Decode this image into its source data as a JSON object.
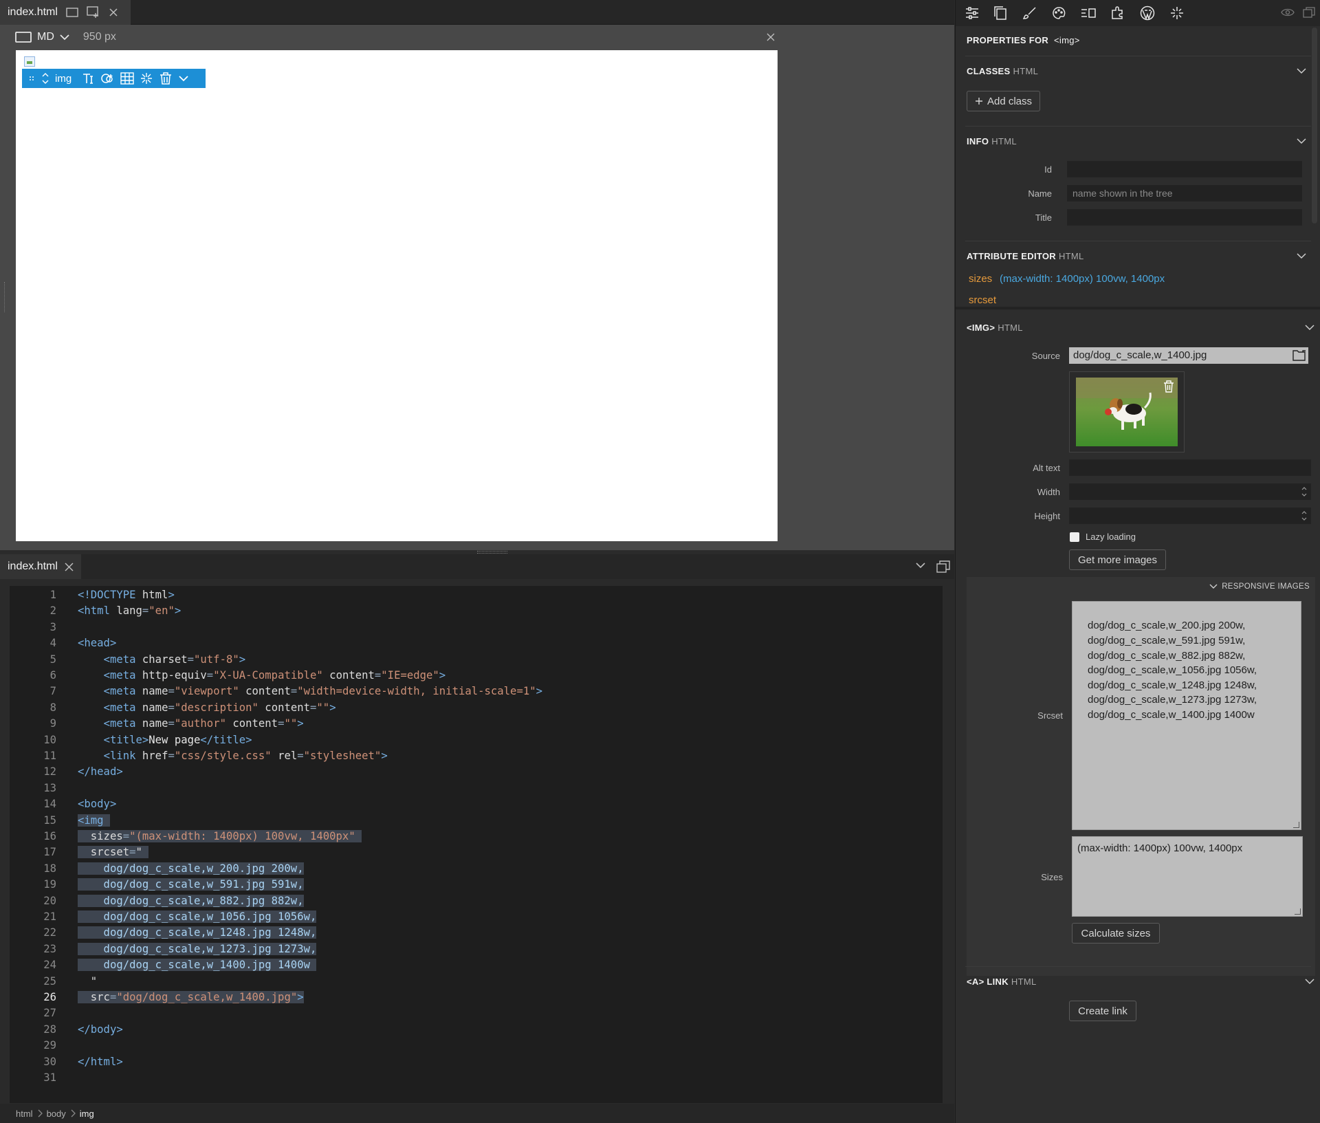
{
  "document_tab": {
    "title": "index.html"
  },
  "viewport": {
    "breakpoint": "MD",
    "width": "950 px"
  },
  "element_toolbar": {
    "tag": "img"
  },
  "code_tab": {
    "title": "index.html"
  },
  "code_lines": [
    {
      "n": "1",
      "tokens": [
        [
          "t-tag",
          "<!DOCTYPE "
        ],
        [
          "t-attr",
          "html"
        ],
        [
          "t-tag",
          ">"
        ]
      ]
    },
    {
      "n": "2",
      "tokens": [
        [
          "t-tag",
          "<html "
        ],
        [
          "t-attr",
          "lang"
        ],
        [
          "t-punc",
          "="
        ],
        [
          "t-val",
          "\"en\""
        ],
        [
          "t-tag",
          ">"
        ]
      ]
    },
    {
      "n": "3",
      "tokens": []
    },
    {
      "n": "4",
      "tokens": [
        [
          "t-tag",
          "<head>"
        ]
      ]
    },
    {
      "n": "5",
      "tokens": [
        [
          "t-plain",
          "    "
        ],
        [
          "t-tag",
          "<meta "
        ],
        [
          "t-attr",
          "charset"
        ],
        [
          "t-punc",
          "="
        ],
        [
          "t-val",
          "\"utf-8\""
        ],
        [
          "t-tag",
          ">"
        ]
      ]
    },
    {
      "n": "6",
      "tokens": [
        [
          "t-plain",
          "    "
        ],
        [
          "t-tag",
          "<meta "
        ],
        [
          "t-attr",
          "http-equiv"
        ],
        [
          "t-punc",
          "="
        ],
        [
          "t-val",
          "\"X-UA-Compatible\""
        ],
        [
          "t-attr",
          " content"
        ],
        [
          "t-punc",
          "="
        ],
        [
          "t-val",
          "\"IE=edge\""
        ],
        [
          "t-tag",
          ">"
        ]
      ]
    },
    {
      "n": "7",
      "tokens": [
        [
          "t-plain",
          "    "
        ],
        [
          "t-tag",
          "<meta "
        ],
        [
          "t-attr",
          "name"
        ],
        [
          "t-punc",
          "="
        ],
        [
          "t-val",
          "\"viewport\""
        ],
        [
          "t-attr",
          " content"
        ],
        [
          "t-punc",
          "="
        ],
        [
          "t-val",
          "\"width=device-width, initial-scale=1\""
        ],
        [
          "t-tag",
          ">"
        ]
      ]
    },
    {
      "n": "8",
      "tokens": [
        [
          "t-plain",
          "    "
        ],
        [
          "t-tag",
          "<meta "
        ],
        [
          "t-attr",
          "name"
        ],
        [
          "t-punc",
          "="
        ],
        [
          "t-val",
          "\"description\""
        ],
        [
          "t-attr",
          " content"
        ],
        [
          "t-punc",
          "="
        ],
        [
          "t-val",
          "\"\""
        ],
        [
          "t-tag",
          ">"
        ]
      ]
    },
    {
      "n": "9",
      "tokens": [
        [
          "t-plain",
          "    "
        ],
        [
          "t-tag",
          "<meta "
        ],
        [
          "t-attr",
          "name"
        ],
        [
          "t-punc",
          "="
        ],
        [
          "t-val",
          "\"author\""
        ],
        [
          "t-attr",
          " content"
        ],
        [
          "t-punc",
          "="
        ],
        [
          "t-val",
          "\"\""
        ],
        [
          "t-tag",
          ">"
        ]
      ]
    },
    {
      "n": "10",
      "tokens": [
        [
          "t-plain",
          "    "
        ],
        [
          "t-tag",
          "<title>"
        ],
        [
          "t-text",
          "New page"
        ],
        [
          "t-tag",
          "</title>"
        ]
      ]
    },
    {
      "n": "11",
      "tokens": [
        [
          "t-plain",
          "    "
        ],
        [
          "t-tag",
          "<link "
        ],
        [
          "t-attr",
          "href"
        ],
        [
          "t-punc",
          "="
        ],
        [
          "t-val",
          "\"css/style.css\""
        ],
        [
          "t-attr",
          " rel"
        ],
        [
          "t-punc",
          "="
        ],
        [
          "t-val",
          "\"stylesheet\""
        ],
        [
          "t-tag",
          ">"
        ]
      ]
    },
    {
      "n": "12",
      "tokens": [
        [
          "t-tag",
          "</head>"
        ]
      ]
    },
    {
      "n": "13",
      "tokens": []
    },
    {
      "n": "14",
      "tokens": [
        [
          "t-tag",
          "<body>"
        ]
      ]
    },
    {
      "n": "15",
      "hl": true,
      "tokens": [
        [
          "t-tag",
          "<img "
        ]
      ]
    },
    {
      "n": "16",
      "hl": true,
      "tokens": [
        [
          "t-plain",
          "  "
        ],
        [
          "t-attr",
          "sizes"
        ],
        [
          "t-punc",
          "="
        ],
        [
          "t-val",
          "\"(max-width: 1400px) 100vw, 1400px\" "
        ]
      ]
    },
    {
      "n": "17",
      "hl": true,
      "tokens": [
        [
          "t-plain",
          "  "
        ],
        [
          "t-attr",
          "srcset"
        ],
        [
          "t-punc",
          "="
        ],
        [
          "t-attr",
          "\" "
        ]
      ]
    },
    {
      "n": "18",
      "hl": true,
      "tokens": [
        [
          "t-plain",
          "    dog/dog_c_scale,w_200.jpg 200w,"
        ]
      ]
    },
    {
      "n": "19",
      "hl": true,
      "tokens": [
        [
          "t-plain",
          "    dog/dog_c_scale,w_591.jpg 591w,"
        ]
      ]
    },
    {
      "n": "20",
      "hl": true,
      "tokens": [
        [
          "t-plain",
          "    dog/dog_c_scale,w_882.jpg 882w,"
        ]
      ]
    },
    {
      "n": "21",
      "hl": true,
      "tokens": [
        [
          "t-plain",
          "    dog/dog_c_scale,w_1056.jpg 1056w,"
        ]
      ]
    },
    {
      "n": "22",
      "hl": true,
      "tokens": [
        [
          "t-plain",
          "    dog/dog_c_scale,w_1248.jpg 1248w,"
        ]
      ]
    },
    {
      "n": "23",
      "hl": true,
      "tokens": [
        [
          "t-plain",
          "    dog/dog_c_scale,w_1273.jpg 1273w,"
        ]
      ]
    },
    {
      "n": "24",
      "hl": true,
      "tokens": [
        [
          "t-plain",
          "    dog/dog_c_scale,w_1400.jpg 1400w "
        ]
      ]
    },
    {
      "n": "25",
      "tokens": [
        [
          "t-plain",
          "  "
        ],
        [
          "t-attr",
          "\""
        ]
      ]
    },
    {
      "n": "26",
      "hl": true,
      "active": true,
      "tokens": [
        [
          "t-plain",
          "  "
        ],
        [
          "t-attr",
          "src"
        ],
        [
          "t-punc",
          "="
        ],
        [
          "t-val",
          "\"dog/dog_c_scale,w_1400.jpg\""
        ],
        [
          "t-tag",
          ">"
        ]
      ]
    },
    {
      "n": "27",
      "tokens": []
    },
    {
      "n": "28",
      "tokens": [
        [
          "t-tag",
          "</body>"
        ]
      ]
    },
    {
      "n": "29",
      "tokens": []
    },
    {
      "n": "30",
      "tokens": [
        [
          "t-tag",
          "</html>"
        ]
      ]
    },
    {
      "n": "31",
      "tokens": []
    }
  ],
  "breadcrumb": [
    "html",
    "body",
    "img"
  ],
  "props": {
    "header": "PROPERTIES FOR",
    "header_tag": "<img>",
    "classes": {
      "title": "CLASSES",
      "kind": "HTML",
      "add_label": "Add class"
    },
    "info": {
      "title": "INFO",
      "kind": "HTML",
      "id_label": "Id",
      "id_value": "",
      "name_label": "Name",
      "name_placeholder": "name shown in the tree",
      "title_label": "Title",
      "title_value": ""
    },
    "attr_editor": {
      "title": "ATTRIBUTE EDITOR",
      "kind": "HTML",
      "attrs": [
        {
          "name": "sizes",
          "value": "(max-width: 1400px) 100vw, 1400px"
        },
        {
          "name": "srcset",
          "value": ""
        }
      ]
    },
    "img_section": {
      "title": "<IMG>",
      "kind": "HTML",
      "source_label": "Source",
      "source_value": "dog/dog_c_scale,w_1400.jpg",
      "alt_label": "Alt text",
      "alt_value": "",
      "width_label": "Width",
      "width_value": "",
      "height_label": "Height",
      "height_value": "",
      "lazy_label": "Lazy loading",
      "lazy_checked": false,
      "more_images_label": "Get more images"
    },
    "responsive": {
      "title": "RESPONSIVE IMAGES",
      "srcset_label": "Srcset",
      "srcset_lines": [
        "dog/dog_c_scale,w_200.jpg 200w,",
        "dog/dog_c_scale,w_591.jpg 591w,",
        "dog/dog_c_scale,w_882.jpg 882w,",
        "dog/dog_c_scale,w_1056.jpg 1056w,",
        "dog/dog_c_scale,w_1248.jpg 1248w,",
        "dog/dog_c_scale,w_1273.jpg 1273w,",
        "dog/dog_c_scale,w_1400.jpg 1400w"
      ],
      "sizes_label": "Sizes",
      "sizes_value": "(max-width: 1400px) 100vw, 1400px",
      "calc_label": "Calculate sizes"
    },
    "link": {
      "title": "<A> LINK",
      "kind": "HTML",
      "create_label": "Create link"
    }
  },
  "colors": {
    "accent": "#1d8fd6",
    "attr_name": "#e69a3c",
    "attr_value": "#4aa8e0"
  }
}
